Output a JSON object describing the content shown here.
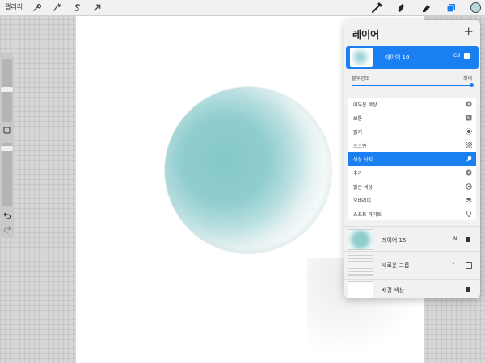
{
  "topbar": {
    "gallery_label": "갤러리",
    "left_tools": [
      "wrench-icon",
      "magic-wand-icon",
      "selection-s-icon",
      "transform-arrow-icon"
    ],
    "right_tools": [
      "brush-icon",
      "smudge-icon",
      "eraser-icon",
      "layers-icon",
      "color-circle-icon"
    ],
    "accent": "#1a7ff0",
    "active_color": "#b9dadb"
  },
  "sidebar": {
    "undo_icon": "undo-icon",
    "redo_icon": "redo-icon",
    "modify_icon": "square-modify-icon"
  },
  "panel": {
    "title": "레이어",
    "add_label": "+",
    "active_layer": {
      "name": "레이어 16",
      "mode": "Cd"
    },
    "opacity": {
      "label": "불투명도",
      "value": "최대",
      "fraction": 1.0
    },
    "blend_modes": [
      {
        "label": "어두운 색상",
        "icon": "darker-color-icon"
      },
      {
        "label": "보통",
        "icon": "normal-icon"
      },
      {
        "label": "밝기",
        "icon": "brightness-icon"
      },
      {
        "label": "스크린",
        "icon": "screen-icon"
      },
      {
        "label": "색상 닷지",
        "icon": "color-dodge-icon",
        "selected": true
      },
      {
        "label": "추가",
        "icon": "add-icon"
      },
      {
        "label": "밝은 색상",
        "icon": "lighter-color-icon"
      },
      {
        "label": "오버레이",
        "icon": "overlay-icon"
      },
      {
        "label": "소프트 라이트",
        "icon": "soft-light-icon"
      }
    ],
    "layers": [
      {
        "name": "레이어 15",
        "mode": "N"
      },
      {
        "name": "새로운 그룹"
      },
      {
        "name": "배경 색상"
      }
    ]
  },
  "colors": {
    "sphere": "#8fcdcf",
    "panel_bg": "#f1f1f1"
  }
}
